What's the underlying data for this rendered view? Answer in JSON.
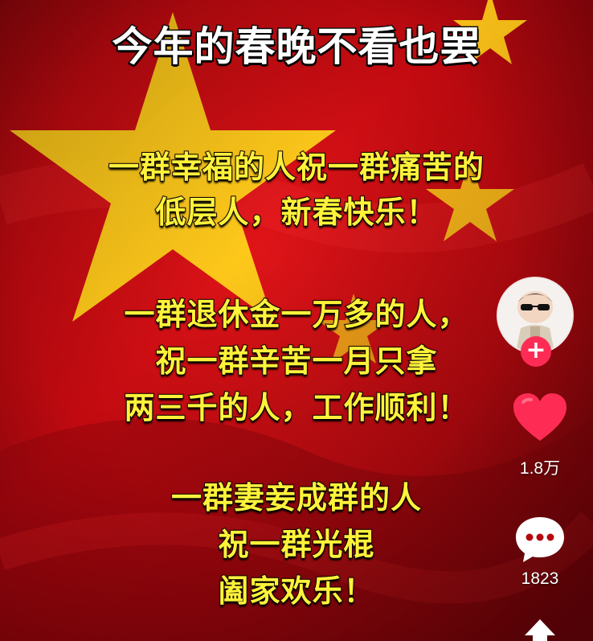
{
  "video": {
    "title": "今年的春晚不看也罢",
    "paragraphs": [
      [
        "一群幸福的人祝一群痛苦的",
        "低层人，新春快乐！"
      ],
      [
        "一群退休金一万多的人，",
        "祝一群辛苦一月只拿",
        "两三千的人，工作顺利！"
      ],
      [
        "一群妻妾成群的人",
        "祝一群光棍",
        "阖家欢乐！"
      ]
    ]
  },
  "sidebar": {
    "follow_label": "+",
    "like_count": "1.8万",
    "comment_count": "1823"
  },
  "icons": {
    "avatar": "avatar-icon",
    "like": "heart-icon",
    "comment": "comment-icon",
    "share": "share-icon"
  },
  "colors": {
    "background": "#b5080f",
    "star": "#ffd21a",
    "caption_text": "#fff23a",
    "title_text": "#ffffff",
    "like": "#fe2c55",
    "accent": "#fe2c55"
  }
}
